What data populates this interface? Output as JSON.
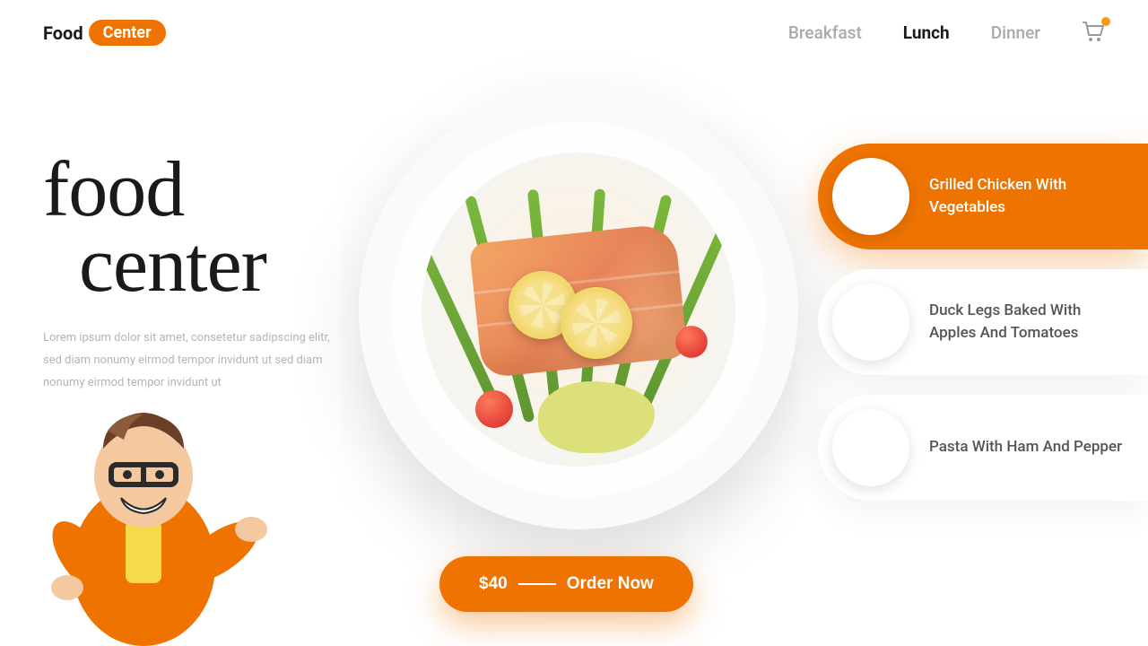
{
  "brand": {
    "word1": "Food",
    "word2": "Center"
  },
  "nav": {
    "items": [
      {
        "label": "Breakfast",
        "active": false
      },
      {
        "label": "Lunch",
        "active": true
      },
      {
        "label": "Dinner",
        "active": false
      }
    ]
  },
  "hero": {
    "title_line1": "food",
    "title_line2": "center",
    "description": "Lorem ipsum dolor sit amet, consetetur sadipscing elitr, sed diam nonumy eirmod tempor invidunt ut sed diam nonumy eirmod tempor invidunt ut"
  },
  "order": {
    "price": "$40",
    "cta": "Order Now"
  },
  "menu": {
    "items": [
      {
        "label": "Grilled Chicken With Vegetables",
        "active": true
      },
      {
        "label": "Duck Legs Baked With Apples And Tomatoes",
        "active": false
      },
      {
        "label": "Pasta With Ham And Pepper",
        "active": false
      }
    ]
  },
  "colors": {
    "accent": "#ee7300"
  }
}
